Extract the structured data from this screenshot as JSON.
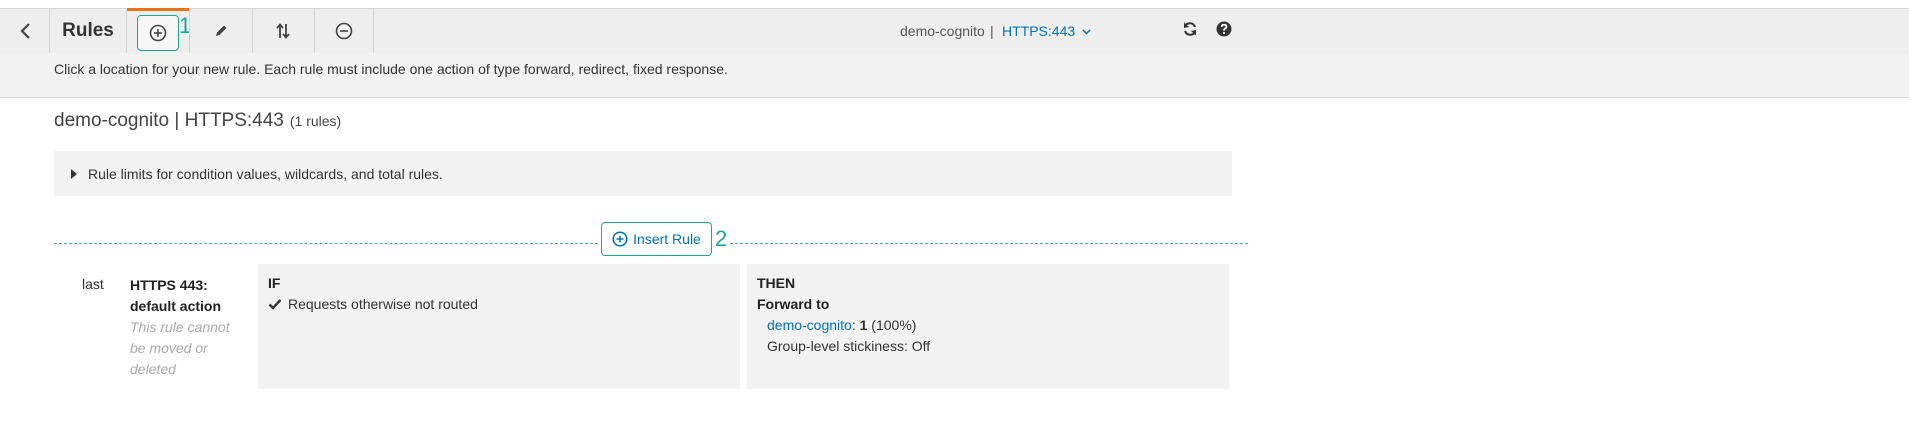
{
  "toolbar": {
    "title": "Rules",
    "lb_name": "demo-cognito",
    "separator": "|",
    "listener": "HTTPS:443",
    "buttons": [
      "back",
      "add",
      "edit",
      "reorder",
      "delete"
    ]
  },
  "annotations": {
    "one": "1",
    "two": "2"
  },
  "hint": {
    "text": "Click a location for your new rule. Each rule must include one action of type forward, redirect, fixed response."
  },
  "heading": {
    "title": "demo-cognito | HTTPS:443",
    "count": "(1 rules)"
  },
  "limits": {
    "text": "Rule limits for condition values, wildcards, and total rules."
  },
  "insert": {
    "label": "Insert Rule"
  },
  "rule": {
    "priority": "last",
    "name_line1": "HTTPS 443:",
    "name_line2": "default action",
    "note_line1": "This rule cannot",
    "note_line2": "be moved or",
    "note_line3": "deleted",
    "if_label": "IF",
    "condition": "Requests otherwise not routed",
    "then_label": "THEN",
    "action_title": "Forward to",
    "target_group": "demo-cognito",
    "weight_sep": ": ",
    "weight": "1",
    "weight_pct": " (100%)",
    "stickiness": "Group-level stickiness: Off"
  },
  "colors": {
    "accent": "#ec7211",
    "annotation": "#1aa894",
    "link": "#0073bb"
  },
  "icons": [
    "chevron-left-icon",
    "plus-circle-icon",
    "pencil-icon",
    "reorder-arrows-icon",
    "minus-circle-icon",
    "refresh-icon",
    "help-icon",
    "chevron-down-icon",
    "caret-right-icon",
    "checkmark-icon"
  ]
}
